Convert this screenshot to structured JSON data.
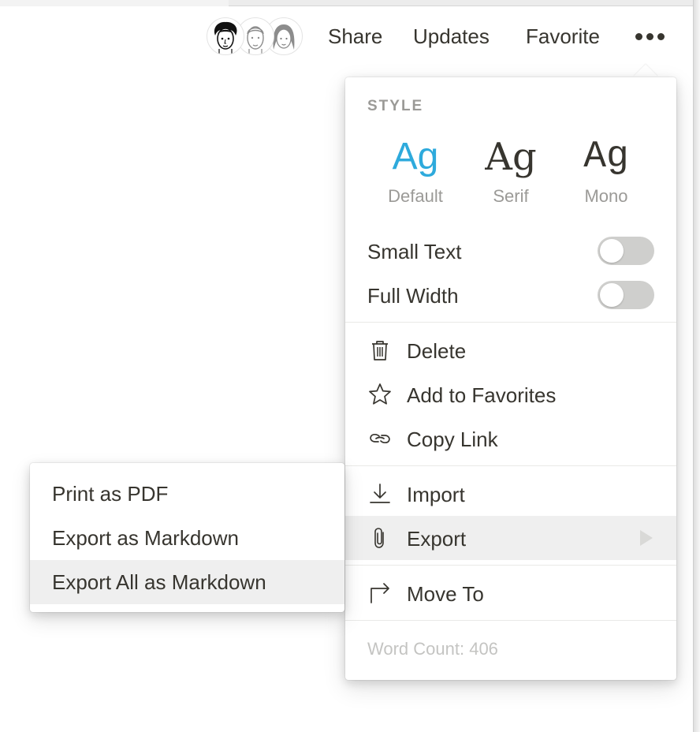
{
  "topbar": {
    "avatars": [
      "user-avatar-1",
      "user-avatar-2",
      "user-avatar-3"
    ],
    "share_label": "Share",
    "updates_label": "Updates",
    "favorite_label": "Favorite",
    "more_icon": "more-horizontal-icon"
  },
  "menu": {
    "style_title": "STYLE",
    "styles": [
      {
        "sample": "Ag",
        "label": "Default",
        "active": true
      },
      {
        "sample": "Ag",
        "label": "Serif",
        "active": false
      },
      {
        "sample": "Ag",
        "label": "Mono",
        "active": false
      }
    ],
    "accent_color": "#2eaadc",
    "toggles": [
      {
        "label": "Small Text",
        "on": false
      },
      {
        "label": "Full Width",
        "on": false
      }
    ],
    "actions": [
      {
        "label": "Delete",
        "icon": "trash-icon"
      },
      {
        "label": "Add to Favorites",
        "icon": "star-icon"
      },
      {
        "label": "Copy Link",
        "icon": "link-icon"
      }
    ],
    "transfer": [
      {
        "label": "Import",
        "icon": "download-icon"
      },
      {
        "label": "Export",
        "icon": "paperclip-icon",
        "highlighted": true
      }
    ],
    "move_to": {
      "label": "Move To",
      "icon": "corner-up-right-icon"
    },
    "word_count": "Word Count: 406"
  },
  "submenu": {
    "items": [
      {
        "label": "Print as PDF",
        "highlighted": false
      },
      {
        "label": "Export as Markdown",
        "highlighted": false
      },
      {
        "label": "Export All as Markdown",
        "highlighted": true
      }
    ]
  }
}
